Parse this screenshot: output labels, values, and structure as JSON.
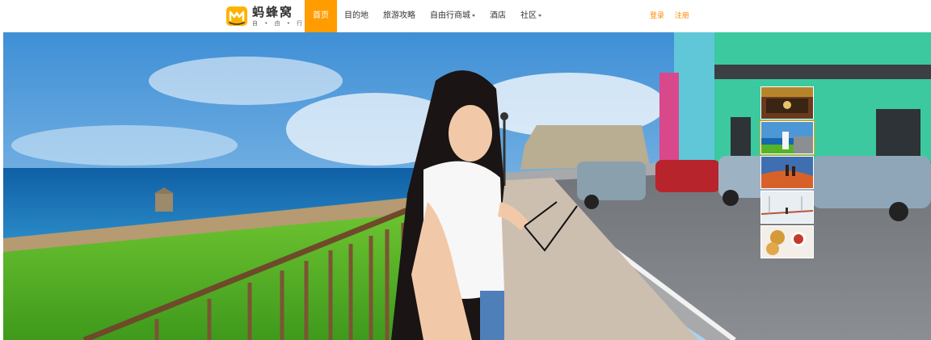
{
  "brand": {
    "name": "蚂蜂窝",
    "tagline": "自 • 由 • 行",
    "accent_color": "#ff9d00",
    "logo_icon": "mafengwo-m-icon"
  },
  "nav": {
    "items": [
      {
        "label": "首页",
        "active": true,
        "has_dropdown": false
      },
      {
        "label": "目的地",
        "active": false,
        "has_dropdown": false
      },
      {
        "label": "旅游攻略",
        "active": false,
        "has_dropdown": false
      },
      {
        "label": "自由行商城",
        "active": false,
        "has_dropdown": true
      },
      {
        "label": "酒店",
        "active": false,
        "has_dropdown": false
      },
      {
        "label": "社区",
        "active": false,
        "has_dropdown": true
      }
    ]
  },
  "auth": {
    "login_label": "登录",
    "register_label": "注册",
    "color": "#ff8a00"
  },
  "hero": {
    "thumbnails": [
      {
        "name": "palace-interior-thumbnail"
      },
      {
        "name": "girl-seaside-thumbnail"
      },
      {
        "name": "desert-camels-thumbnail"
      },
      {
        "name": "snowy-bridge-thumbnail"
      },
      {
        "name": "food-dish-thumbnail"
      }
    ]
  }
}
